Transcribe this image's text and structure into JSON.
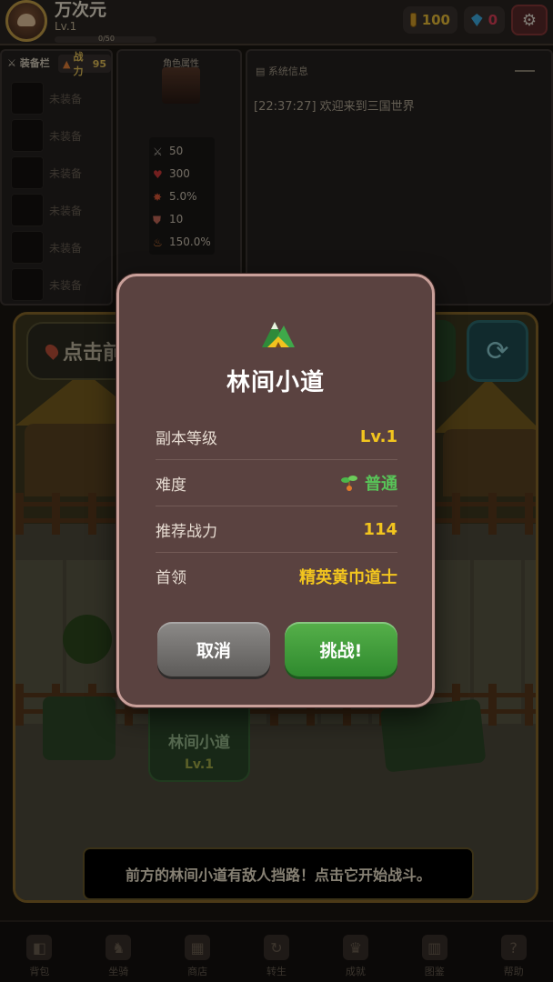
{
  "player": {
    "name": "万次元",
    "level": "Lv.1",
    "exp_text": "0/50"
  },
  "resources": {
    "gold": "100",
    "gems": "0"
  },
  "equipment": {
    "title": "装备栏",
    "power_label": "战力",
    "power_value": "95",
    "slots": [
      {
        "label": "未装备",
        "icon": "sword-icon"
      },
      {
        "label": "未装备",
        "icon": "empty-slot"
      },
      {
        "label": "未装备",
        "icon": "armor-icon"
      },
      {
        "label": "未装备",
        "icon": "boots-icon"
      },
      {
        "label": "未装备",
        "icon": "ring-icon"
      },
      {
        "label": "未装备",
        "icon": "empty-slot"
      }
    ]
  },
  "attributes": {
    "title": "角色属性",
    "rows": [
      {
        "icon": "attack-icon",
        "value": "50"
      },
      {
        "icon": "heart-icon",
        "value": "300"
      },
      {
        "icon": "crit-icon",
        "value": "5.0%"
      },
      {
        "icon": "shield-icon",
        "value": "10"
      },
      {
        "icon": "fire-icon",
        "value": "150.0%"
      }
    ]
  },
  "system": {
    "title": "系统信息",
    "log": [
      "[22:37:27] 欢迎来到三国世界"
    ]
  },
  "map": {
    "search_text": "点击前往",
    "node": {
      "name": "林间小道",
      "level": "Lv.1"
    },
    "hint": "前方的林间小道有敌人挡路！点击它开始战斗。"
  },
  "nav": [
    {
      "label": "背包",
      "icon": "bag-icon"
    },
    {
      "label": "坐骑",
      "icon": "horse-icon"
    },
    {
      "label": "商店",
      "icon": "shop-icon"
    },
    {
      "label": "转生",
      "icon": "rebirth-icon"
    },
    {
      "label": "成就",
      "icon": "trophy-icon"
    },
    {
      "label": "图鉴",
      "icon": "book-icon"
    },
    {
      "label": "帮助",
      "icon": "help-icon"
    }
  ],
  "dialog": {
    "title": "林间小道",
    "rows": [
      {
        "label": "副本等级",
        "value": "Lv.1"
      },
      {
        "label": "难度",
        "value": "普通"
      },
      {
        "label": "推荐战力",
        "value": "114"
      },
      {
        "label": "首领",
        "value": "精英黄巾道士"
      }
    ],
    "cancel_label": "取消",
    "challenge_label": "挑战!"
  },
  "colors": {
    "accent_gold": "#f2c51e",
    "difficulty_green": "#58c458",
    "challenge_button": "#3f9e3a",
    "cancel_button": "#737170",
    "modal_bg": "#5a4240"
  }
}
